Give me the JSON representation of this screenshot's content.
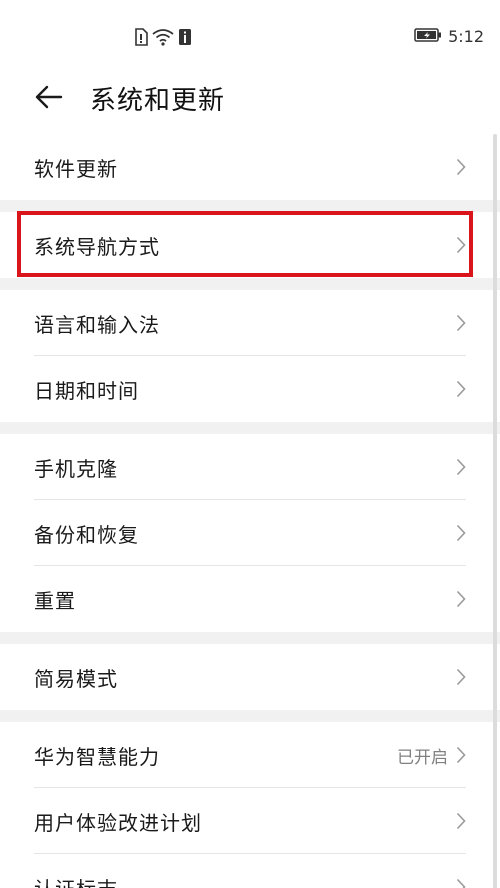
{
  "status_bar": {
    "icons": [
      "sim-card-icon",
      "wifi-icon",
      "info-icon",
      "battery-icon"
    ],
    "time": "5:12"
  },
  "header": {
    "back_icon": "arrow-left-icon",
    "title": "系统和更新"
  },
  "groups": [
    {
      "items": [
        {
          "label": "软件更新"
        }
      ]
    },
    {
      "items": [
        {
          "label": "系统导航方式",
          "highlighted": true
        }
      ]
    },
    {
      "items": [
        {
          "label": "语言和输入法"
        },
        {
          "label": "日期和时间"
        }
      ]
    },
    {
      "items": [
        {
          "label": "手机克隆"
        },
        {
          "label": "备份和恢复"
        },
        {
          "label": "重置"
        }
      ]
    },
    {
      "items": [
        {
          "label": "简易模式"
        }
      ]
    },
    {
      "items": [
        {
          "label": "华为智慧能力",
          "value": "已开启"
        },
        {
          "label": "用户体验改进计划"
        },
        {
          "label": "认证标志"
        }
      ]
    }
  ],
  "colors": {
    "highlight_border": "#d9141b",
    "group_gap": "#f1f1f1",
    "value_text": "#808080"
  }
}
